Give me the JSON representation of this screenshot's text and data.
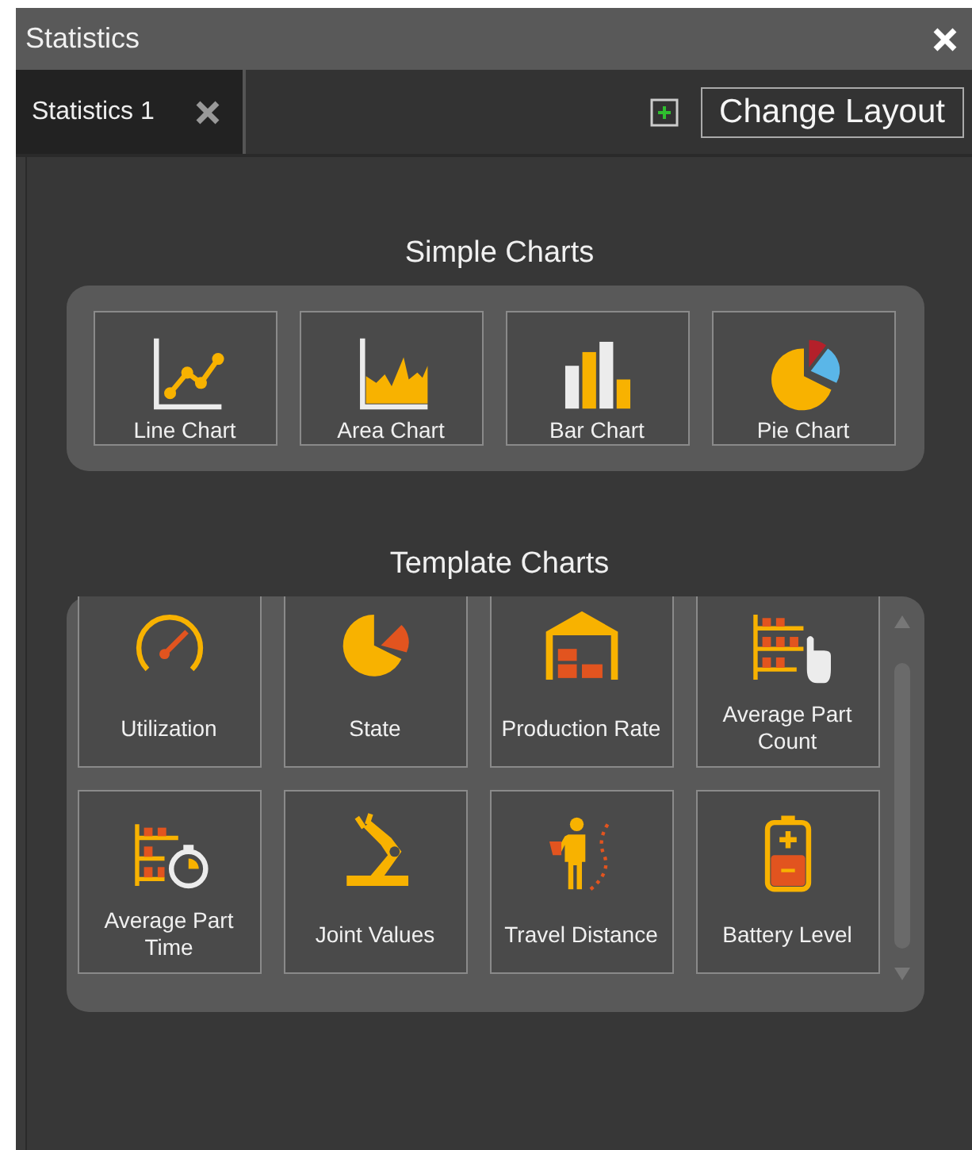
{
  "window": {
    "title": "Statistics"
  },
  "tabs": [
    {
      "label": "Statistics 1",
      "selected": true
    }
  ],
  "toolbar": {
    "change_layout": "Change Layout"
  },
  "simple_charts": {
    "heading": "Simple Charts",
    "items": [
      {
        "label": "Line Chart"
      },
      {
        "label": "Area Chart"
      },
      {
        "label": "Bar Chart"
      },
      {
        "label": "Pie Chart"
      }
    ]
  },
  "template_charts": {
    "heading": "Template Charts",
    "items": [
      {
        "label": "Utilization"
      },
      {
        "label": "State"
      },
      {
        "label": "Production Rate"
      },
      {
        "label": "Average Part Count"
      },
      {
        "label": "Average Part Time"
      },
      {
        "label": "Joint Values"
      },
      {
        "label": "Travel Distance"
      },
      {
        "label": "Battery Level"
      }
    ]
  }
}
